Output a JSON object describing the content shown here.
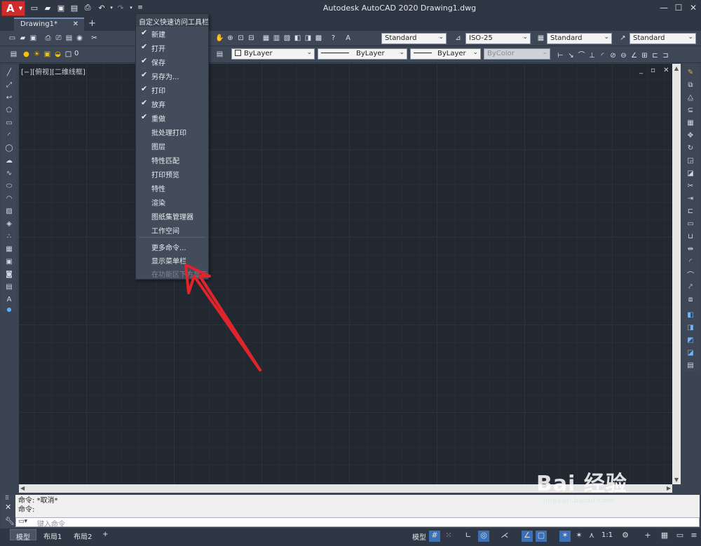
{
  "window": {
    "title": "Autodesk AutoCAD 2020    Drawing1.dwg",
    "controls": [
      "minimize-icon",
      "maximize-icon",
      "close-icon"
    ]
  },
  "quick_access": [
    "new-icon",
    "open-icon",
    "save-icon",
    "saveas-icon",
    "print-icon",
    "undo-icon",
    "redo-icon",
    "customize-icon"
  ],
  "tabs": {
    "active": "Drawing1*",
    "close": "✕",
    "add": "+"
  },
  "toolbar1": {
    "text_style": "Standard",
    "dim_style": "ISO-25",
    "table_style": "Standard",
    "mleader_style": "Standard"
  },
  "toolbar2": {
    "layer": "0",
    "color": "ByLayer",
    "linetype": "ByLayer",
    "lineweight": "ByLayer",
    "plotstyle": "ByColor"
  },
  "viewport": {
    "label": "[−][俯视][二维线框]",
    "controls": "_ ▫ ✕"
  },
  "quick_access_menu": {
    "title": "自定义快速访问工具栏",
    "items": [
      {
        "label": "新建",
        "checked": true
      },
      {
        "label": "打开",
        "checked": true
      },
      {
        "label": "保存",
        "checked": true
      },
      {
        "label": "另存为...",
        "checked": true
      },
      {
        "label": "打印",
        "checked": true
      },
      {
        "label": "放弃",
        "checked": true
      },
      {
        "label": "重做",
        "checked": true
      },
      {
        "label": "批处理打印",
        "checked": false
      },
      {
        "label": "图层",
        "checked": false
      },
      {
        "label": "特性匹配",
        "checked": false
      },
      {
        "label": "打印预览",
        "checked": false
      },
      {
        "label": "特性",
        "checked": false
      },
      {
        "label": "渲染",
        "checked": false
      },
      {
        "label": "图纸集管理器",
        "checked": false
      },
      {
        "label": "工作空间",
        "checked": false
      }
    ],
    "extra": [
      {
        "label": "更多命令..."
      },
      {
        "label": "显示菜单栏"
      },
      {
        "label": "在功能区下方显示"
      }
    ]
  },
  "command": {
    "line1": "命令: *取消*",
    "line2": "命令:",
    "placeholder": "键入命令"
  },
  "layout_tabs": [
    "模型",
    "布局1",
    "布局2",
    "+"
  ],
  "status": {
    "model": "模型",
    "scale": "1:1"
  },
  "watermark": {
    "brand": "Bai  经验",
    "url": "jingyan.baidu.com"
  },
  "colors": {
    "annotation_arrow": "#e0242c",
    "canvas": "#212830",
    "menu_bg": "#434c5b"
  }
}
